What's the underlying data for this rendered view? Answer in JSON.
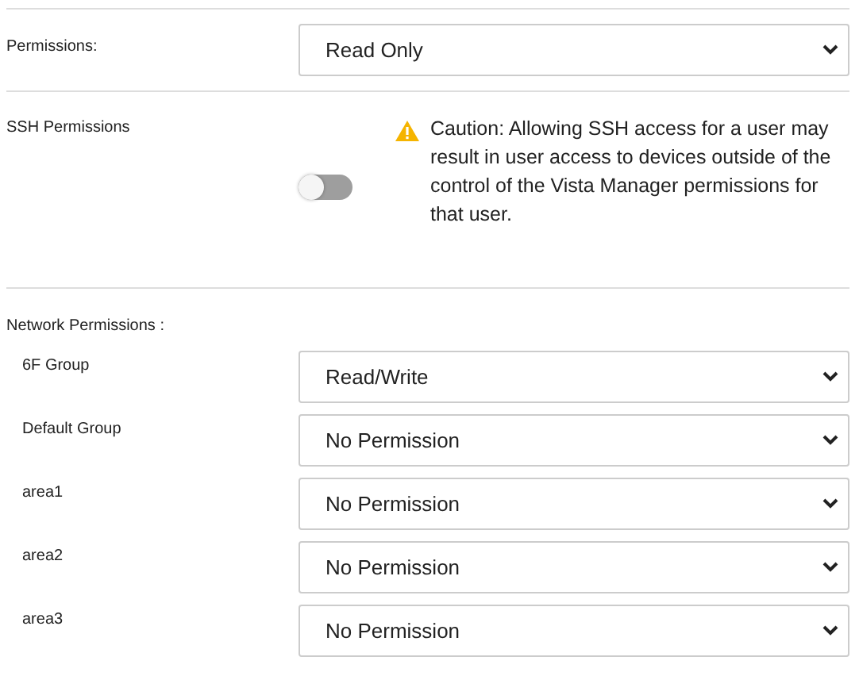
{
  "permissions": {
    "label": "Permissions:",
    "value": "Read Only"
  },
  "ssh": {
    "label": "SSH Permissions",
    "on": false,
    "caution": "Caution: Allowing SSH access for a user may result in user access to devices outside of the control of the Vista Manager permissions for that user."
  },
  "network": {
    "label": "Network Permissions :",
    "groups": [
      {
        "name": "6F Group",
        "value": "Read/Write"
      },
      {
        "name": "Default Group",
        "value": "No Permission"
      },
      {
        "name": "area1",
        "value": "No Permission"
      },
      {
        "name": "area2",
        "value": "No Permission"
      },
      {
        "name": "area3",
        "value": "No Permission"
      }
    ]
  }
}
